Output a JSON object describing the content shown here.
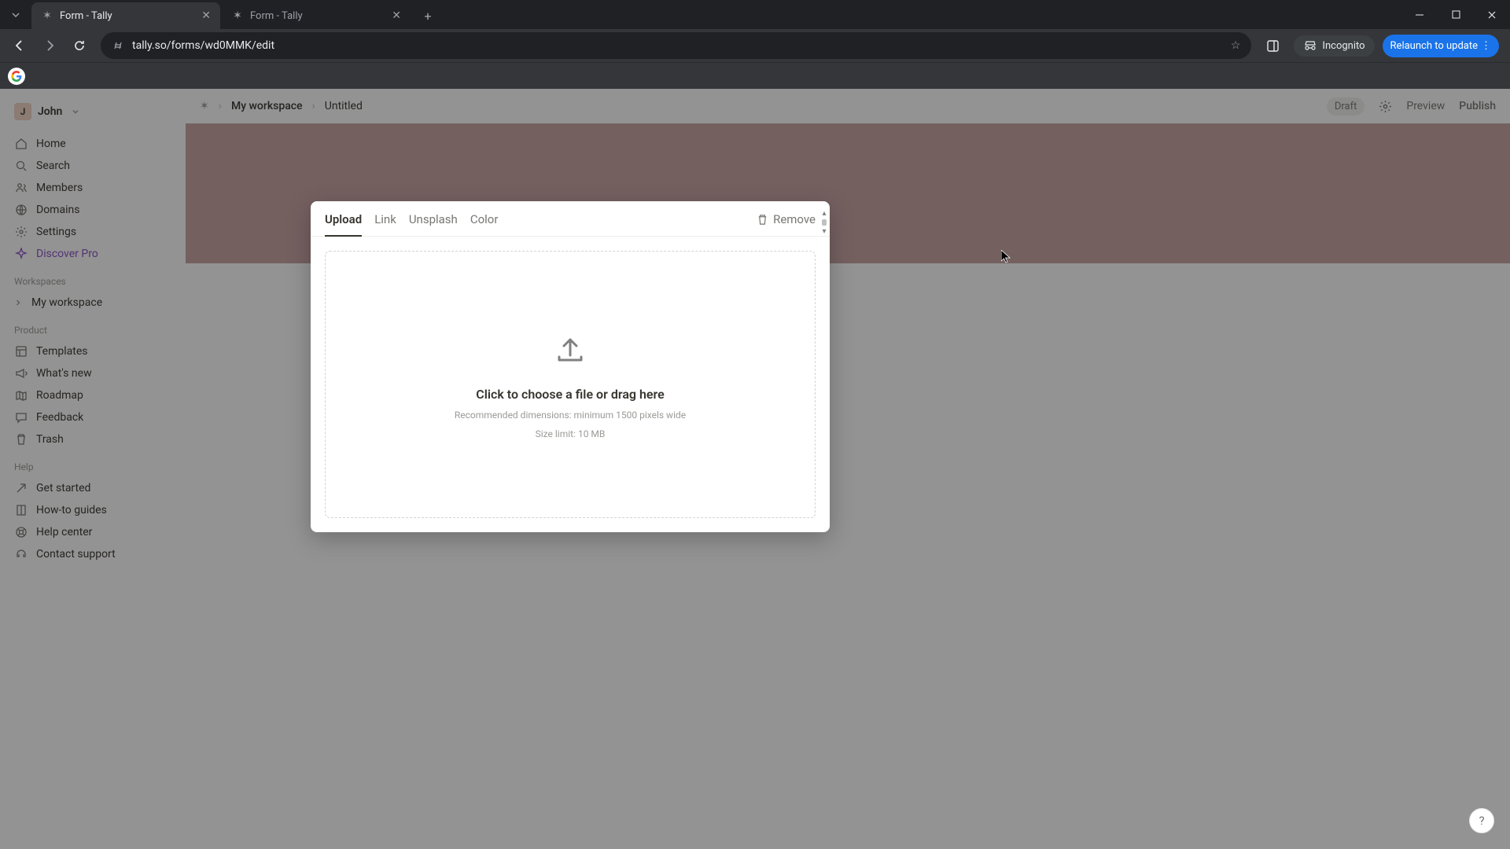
{
  "browser": {
    "tabs": [
      {
        "title": "Form - Tally",
        "active": true
      },
      {
        "title": "Form - Tally",
        "active": false
      }
    ],
    "url": "tally.so/forms/wd0MMK/edit",
    "incognito_label": "Incognito",
    "relaunch_label": "Relaunch to update"
  },
  "user": {
    "initial": "J",
    "name": "John"
  },
  "sidebar": {
    "nav": [
      {
        "label": "Home",
        "icon": "home-icon"
      },
      {
        "label": "Search",
        "icon": "search-icon"
      },
      {
        "label": "Members",
        "icon": "members-icon"
      },
      {
        "label": "Domains",
        "icon": "globe-icon"
      },
      {
        "label": "Settings",
        "icon": "settings-icon"
      },
      {
        "label": "Discover Pro",
        "icon": "sparkle-icon"
      }
    ],
    "workspaces_header": "Workspaces",
    "workspace_item": "My workspace",
    "product_header": "Product",
    "product": [
      {
        "label": "Templates",
        "icon": "templates-icon"
      },
      {
        "label": "What's new",
        "icon": "megaphone-icon"
      },
      {
        "label": "Roadmap",
        "icon": "map-icon"
      },
      {
        "label": "Feedback",
        "icon": "chat-icon"
      },
      {
        "label": "Trash",
        "icon": "trash-icon"
      }
    ],
    "help_header": "Help",
    "help": [
      {
        "label": "Get started",
        "icon": "arrow-icon"
      },
      {
        "label": "How-to guides",
        "icon": "book-icon"
      },
      {
        "label": "Help center",
        "icon": "lifebuoy-icon"
      },
      {
        "label": "Contact support",
        "icon": "support-icon"
      }
    ]
  },
  "topbar": {
    "breadcrumb_root": "My workspace",
    "breadcrumb_page": "Untitled",
    "draft_label": "Draft",
    "preview_label": "Preview",
    "publish_label": "Publish"
  },
  "modal": {
    "tabs": [
      "Upload",
      "Link",
      "Unsplash",
      "Color"
    ],
    "active_tab": "Upload",
    "remove_label": "Remove",
    "dropzone_title": "Click to choose a file or drag here",
    "dropzone_hint1": "Recommended dimensions: minimum 1500 pixels wide",
    "dropzone_hint2": "Size limit: 10 MB"
  },
  "colors": {
    "cover": "#c9a3a3",
    "pro": "#8a52c7",
    "relaunch": "#1a73e8"
  }
}
